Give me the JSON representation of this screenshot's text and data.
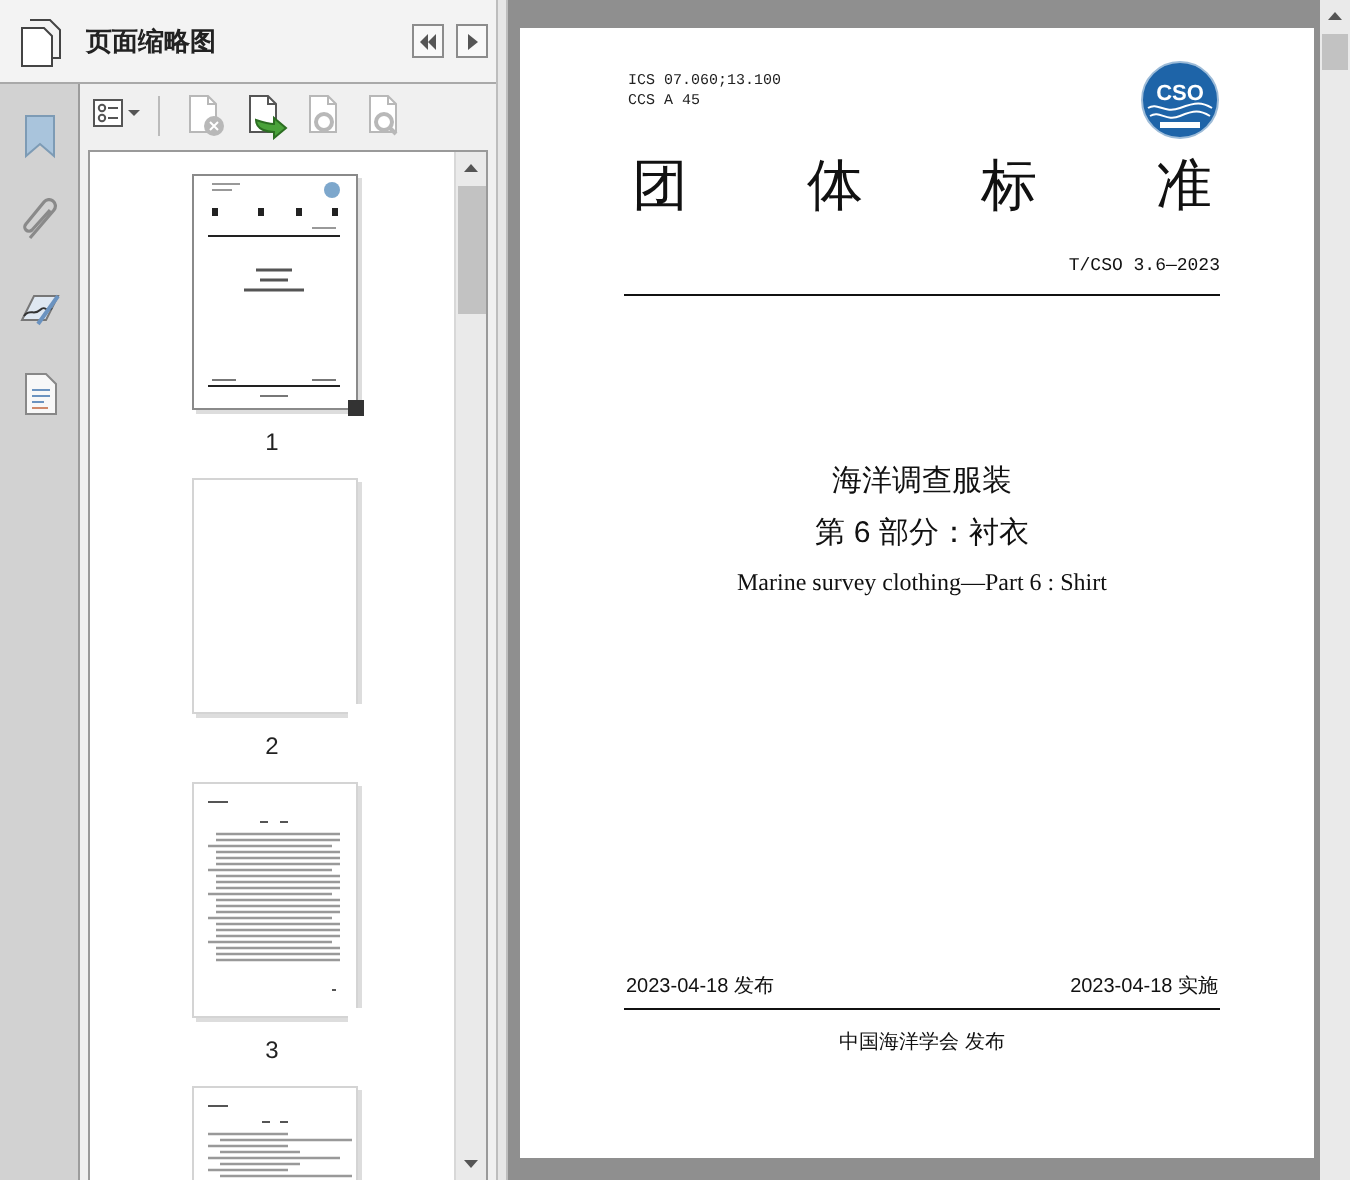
{
  "panel": {
    "title": "页面缩略图"
  },
  "toolbar": [
    {
      "kind": "options",
      "disabled": false
    },
    {
      "kind": "delete",
      "disabled": true
    },
    {
      "kind": "insert",
      "disabled": false
    },
    {
      "kind": "print",
      "disabled": true
    },
    {
      "kind": "enlarge",
      "disabled": true
    }
  ],
  "thumbnails": [
    {
      "label": "1",
      "kind": "cover",
      "selected": true
    },
    {
      "label": "2",
      "kind": "blank",
      "selected": false
    },
    {
      "label": "3",
      "kind": "contents",
      "selected": false
    },
    {
      "kind": "text",
      "selected": false
    }
  ],
  "document": {
    "ics": "ICS 07.060;13.100",
    "ccs": "CCS A 45",
    "logo_text": "CSO",
    "heading": [
      "团",
      "体",
      "标",
      "准"
    ],
    "number": "T/CSO 3.6—2023",
    "title": "海洋调查服装",
    "subtitle": "第 6 部分：衬衣",
    "english_title": "Marine survey clothing—Part 6 : Shirt",
    "issued": "2023-04-18 发布",
    "effective": "2023-04-18 实施",
    "publisher": "中国海洋学会 发布"
  }
}
